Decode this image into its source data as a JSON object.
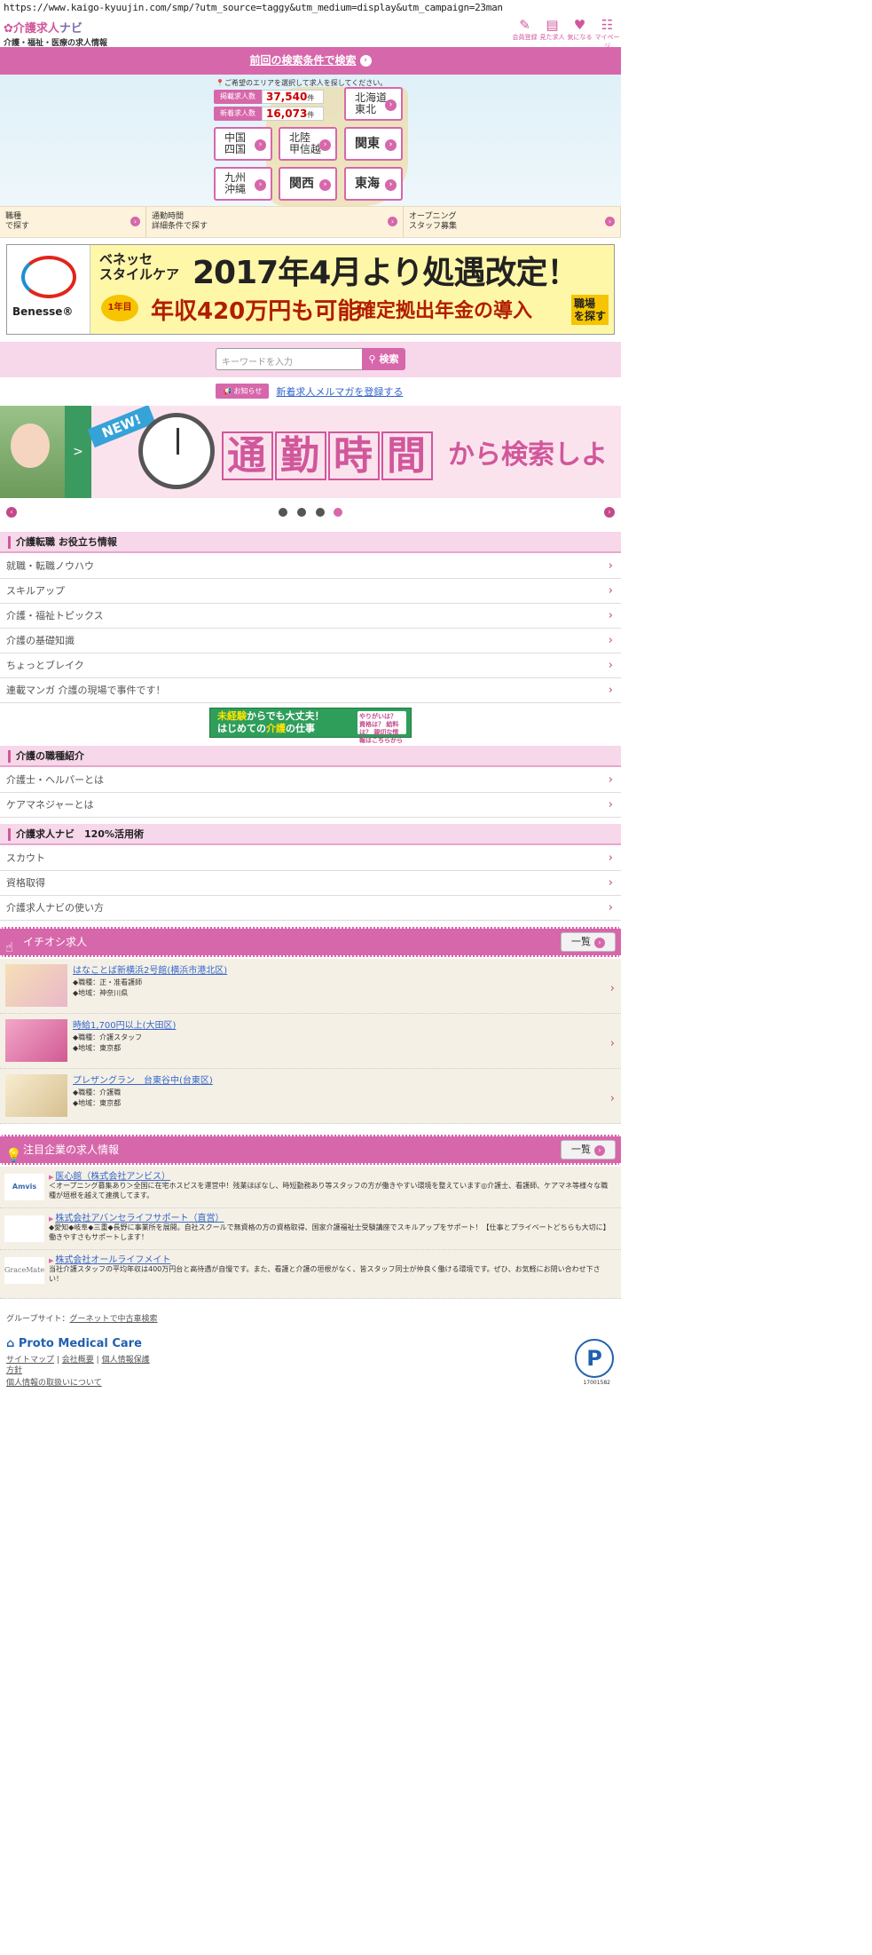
{
  "url": "https://www.kaigo-kyuujin.com/smp/?utm_source=taggy&utm_medium=display&utm_campaign=23man",
  "logo": {
    "name_a": "介護求人",
    "name_b": "ナビ",
    "tagline": "介護・福祉・医療の求人情報"
  },
  "header_icons": [
    {
      "label": "会員登録",
      "icon": "pencil-icon"
    },
    {
      "label": "見た求人",
      "icon": "calendar-icon"
    },
    {
      "label": "気になる",
      "icon": "heart-icon"
    },
    {
      "label": "マイページ",
      "icon": "user-icon"
    }
  ],
  "prev_search": "前回の検索条件で検索",
  "area": {
    "note": "ご希望のエリアを選択して求人を探してください。",
    "total_label": "掲載求人数",
    "total_value": "37,540",
    "total_unit": "件",
    "new_label": "新着求人数",
    "new_value": "16,073",
    "new_unit": "件",
    "regions": [
      "北海道\n東北",
      "中国\n四国",
      "北陸\n甲信越",
      "関東",
      "九州\n沖縄",
      "関西",
      "東海"
    ]
  },
  "categories": [
    "職種\nで探す",
    "通勤時間\n詳細条件で探す",
    "オープニング\nスタッフ募集"
  ],
  "banner": {
    "brand": "Benesse®",
    "line1": "ベネッセ\nスタイルケア",
    "line2": "2017年4月より処遇改定！",
    "badge": "1年目",
    "line3": "年収420万円も可能",
    "line4": "確定拠出年金の導入",
    "cta": "職場\nを探す"
  },
  "search": {
    "placeholder": "キーワードを入力",
    "button": "検索"
  },
  "notice": {
    "tag": "お知らせ",
    "link": "新着求人メルマガを登録する"
  },
  "hero": {
    "new": "NEW!",
    "arrow": ">",
    "chars": [
      "通",
      "勤",
      "時",
      "間"
    ],
    "tail": "から検索しよ"
  },
  "section1": {
    "title": "介護転職 お役立ち情報",
    "items": [
      "就職・転職ノウハウ",
      "スキルアップ",
      "介護・福祉トピックス",
      "介護の基礎知識",
      "ちょっとブレイク",
      "連載マンガ 介護の現場で事件です！"
    ]
  },
  "mini_banner": {
    "line1a": "未経験",
    "line1b": "からでも大丈夫！",
    "line2a": "はじめての",
    "line2b": "介護",
    "line2c": "の仕事",
    "box": "やりがいは？ 資格は？ 給料は？ 親切な情報はこちらから"
  },
  "section2": {
    "title": "介護の職種紹介",
    "items": [
      "介護士・ヘルパーとは",
      "ケアマネジャーとは"
    ]
  },
  "section3": {
    "title": "介護求人ナビ　120%活用術",
    "items": [
      "スカウト",
      "資格取得",
      "介護求人ナビの使い方"
    ]
  },
  "pickup": {
    "title": "イチオシ求人",
    "all": "一覧",
    "items": [
      {
        "title": "はなことば新横浜2号館(横浜市港北区)",
        "job": "◆職種：正・准看護師",
        "area": "◆地域：神奈川県",
        "img": "プラウドライフ"
      },
      {
        "title": "時給1,700円以上(大田区)",
        "job": "◆職種：介護スタッフ",
        "area": "◆地域：東京都",
        "img": "2019"
      },
      {
        "title": "プレザングラン　台東谷中(台東区)",
        "job": "◆職種：介護職",
        "area": "◆地域：東京都",
        "img": ""
      }
    ]
  },
  "companies": {
    "title": "注目企業の求人情報",
    "all": "一覧",
    "items": [
      {
        "logo": "Amvis",
        "name": "医心館（株式会社アンビス）",
        "text": "＜オープニング募集あり＞全国に在宅ホスピスを運営中！残業ほぼなし、時短勤務あり等スタッフの方が働きやすい環境を整えています◎介護士、看護師、ケアマネ等様々な職種が垣根を越えて連携してます。"
      },
      {
        "logo": "",
        "name": "株式会社アバンセライフサポート（直営）",
        "text": "◆愛知◆岐阜◆三重◆長野に事業所を展開。自社スクールで無資格の方の資格取得、国家介護福祉士受験講座でスキルアップをサポート！【仕事とプライベートどちらも大切に】働きやすさもサポートします！"
      },
      {
        "logo": "GraceMate",
        "name": "株式会社オールライフメイト",
        "text": "当社介護スタッフの平均年収は400万円台と高待遇が自慢です。また、看護と介護の垣根がなく、皆スタッフ同士が仲良く働ける環境です。ぜひ、お気軽にお問い合わせ下さい！"
      }
    ]
  },
  "footer": {
    "group_label": "グループサイト：",
    "group_link": "グーネットで中古車検索",
    "brand": "Proto Medical Care",
    "links1": [
      "サイトマップ",
      "会社概要",
      "個人情報保護"
    ],
    "links2": "方針",
    "links3": "個人情報の取扱いについて",
    "pmark": "P",
    "pnum": "17001582"
  }
}
